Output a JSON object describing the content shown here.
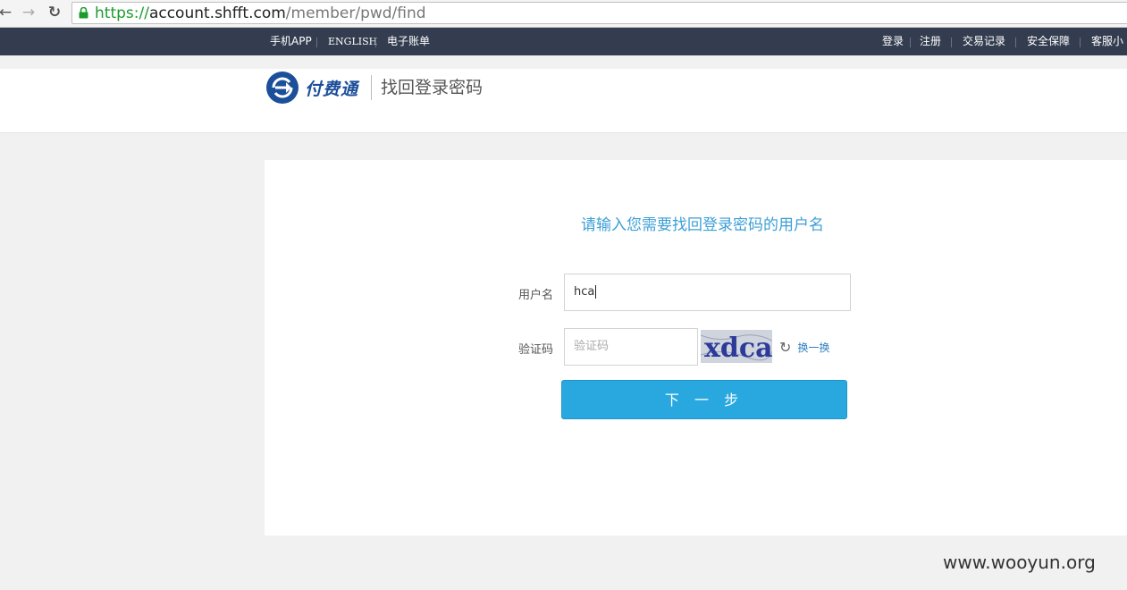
{
  "browser": {
    "url_scheme": "https://",
    "url_host": "account.shfft.com",
    "url_path": "/member/pwd/find"
  },
  "topnav": {
    "left_links": [
      "手机APP",
      "ENGLISH",
      "电子账单"
    ],
    "right_links": [
      "登录",
      "注册",
      "交易记录",
      "安全保障",
      "客服小"
    ]
  },
  "header": {
    "logo_text": "付费通",
    "title": "找回登录密码"
  },
  "form": {
    "prompt": "请输入您需要找回登录密码的用户名",
    "username_label": "用户名",
    "username_value": "hca",
    "captcha_label": "验证码",
    "captcha_placeholder": "验证码",
    "captcha_image_text": "xdca",
    "refresh_label": "换一换",
    "next_button": "下 一 步"
  },
  "watermark": "www.wooyun.org",
  "colors": {
    "topnav_bg": "#333d4f",
    "accent": "#29a8e0",
    "prompt_text": "#3c9fd6",
    "logo_blue": "#1c4f9a"
  }
}
